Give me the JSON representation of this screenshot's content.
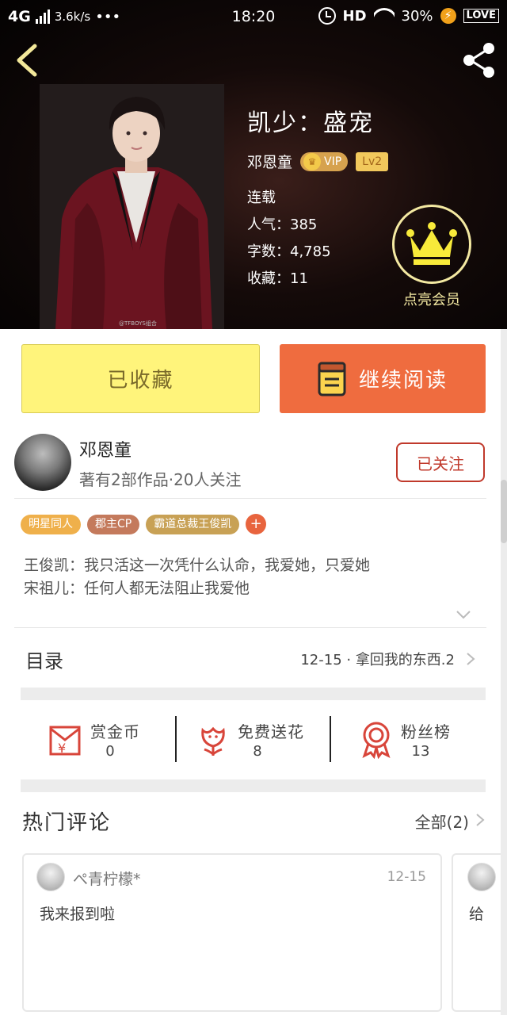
{
  "status_bar": {
    "network": "4G",
    "speed": "3.6k/s",
    "dots": "•••",
    "time": "18:20",
    "hd": "HD",
    "battery": "30%",
    "brand": "LOVE"
  },
  "book": {
    "title": "凯少：盛宠",
    "author": "邓恩童",
    "vip_label": "VIP",
    "level": "Lv2",
    "status": "连载",
    "popularity_label": "人气：",
    "popularity": "385",
    "words_label": "字数：",
    "words": "4,785",
    "favorites_label": "收藏：",
    "favorites": "11",
    "cover_caption": "@TFBOYS组合"
  },
  "member": {
    "label": "点亮会员"
  },
  "actions": {
    "favorited_label": "已收藏",
    "continue_label": "继续阅读"
  },
  "author_section": {
    "name": "邓恩童",
    "meta": "著有2部作品·20人关注",
    "follow_label": "已关注"
  },
  "tags": [
    {
      "label": "明星同人",
      "color": "#efb04b"
    },
    {
      "label": "郡主CP",
      "color": "#c47a5c"
    },
    {
      "label": "霸道总裁王俊凯",
      "color": "#c8a155"
    }
  ],
  "tag_add": "+",
  "description": {
    "line1": "王俊凯：我只活这一次凭什么认命，我爱她，只爱她",
    "line2": "宋祖儿：任何人都无法阻止我爱他"
  },
  "toc": {
    "label": "目录",
    "latest": "12-15 · 拿回我的东西.2"
  },
  "rewards": [
    {
      "label": "赏金币",
      "value": "0"
    },
    {
      "label": "免费送花",
      "value": "8"
    },
    {
      "label": "粉丝榜",
      "value": "13"
    }
  ],
  "comments_section": {
    "title": "热门评论",
    "all_label": "全部(2)",
    "items": [
      {
        "user": "ぺ青柠檬*",
        "date": "12-15",
        "text": "我来报到啦"
      },
      {
        "user": "",
        "date": "",
        "text": "给"
      }
    ]
  },
  "colors": {
    "accent_orange": "#ef6c3f",
    "fav_yellow": "#fff47b",
    "follow_red": "#c0392b",
    "member_gold": "#f4e9a2"
  },
  "icons": [
    "back-icon",
    "share-icon",
    "crown-icon",
    "book-icon",
    "red-envelope-icon",
    "flower-icon",
    "medal-icon",
    "chevron-right-icon",
    "chevron-down-icon"
  ]
}
